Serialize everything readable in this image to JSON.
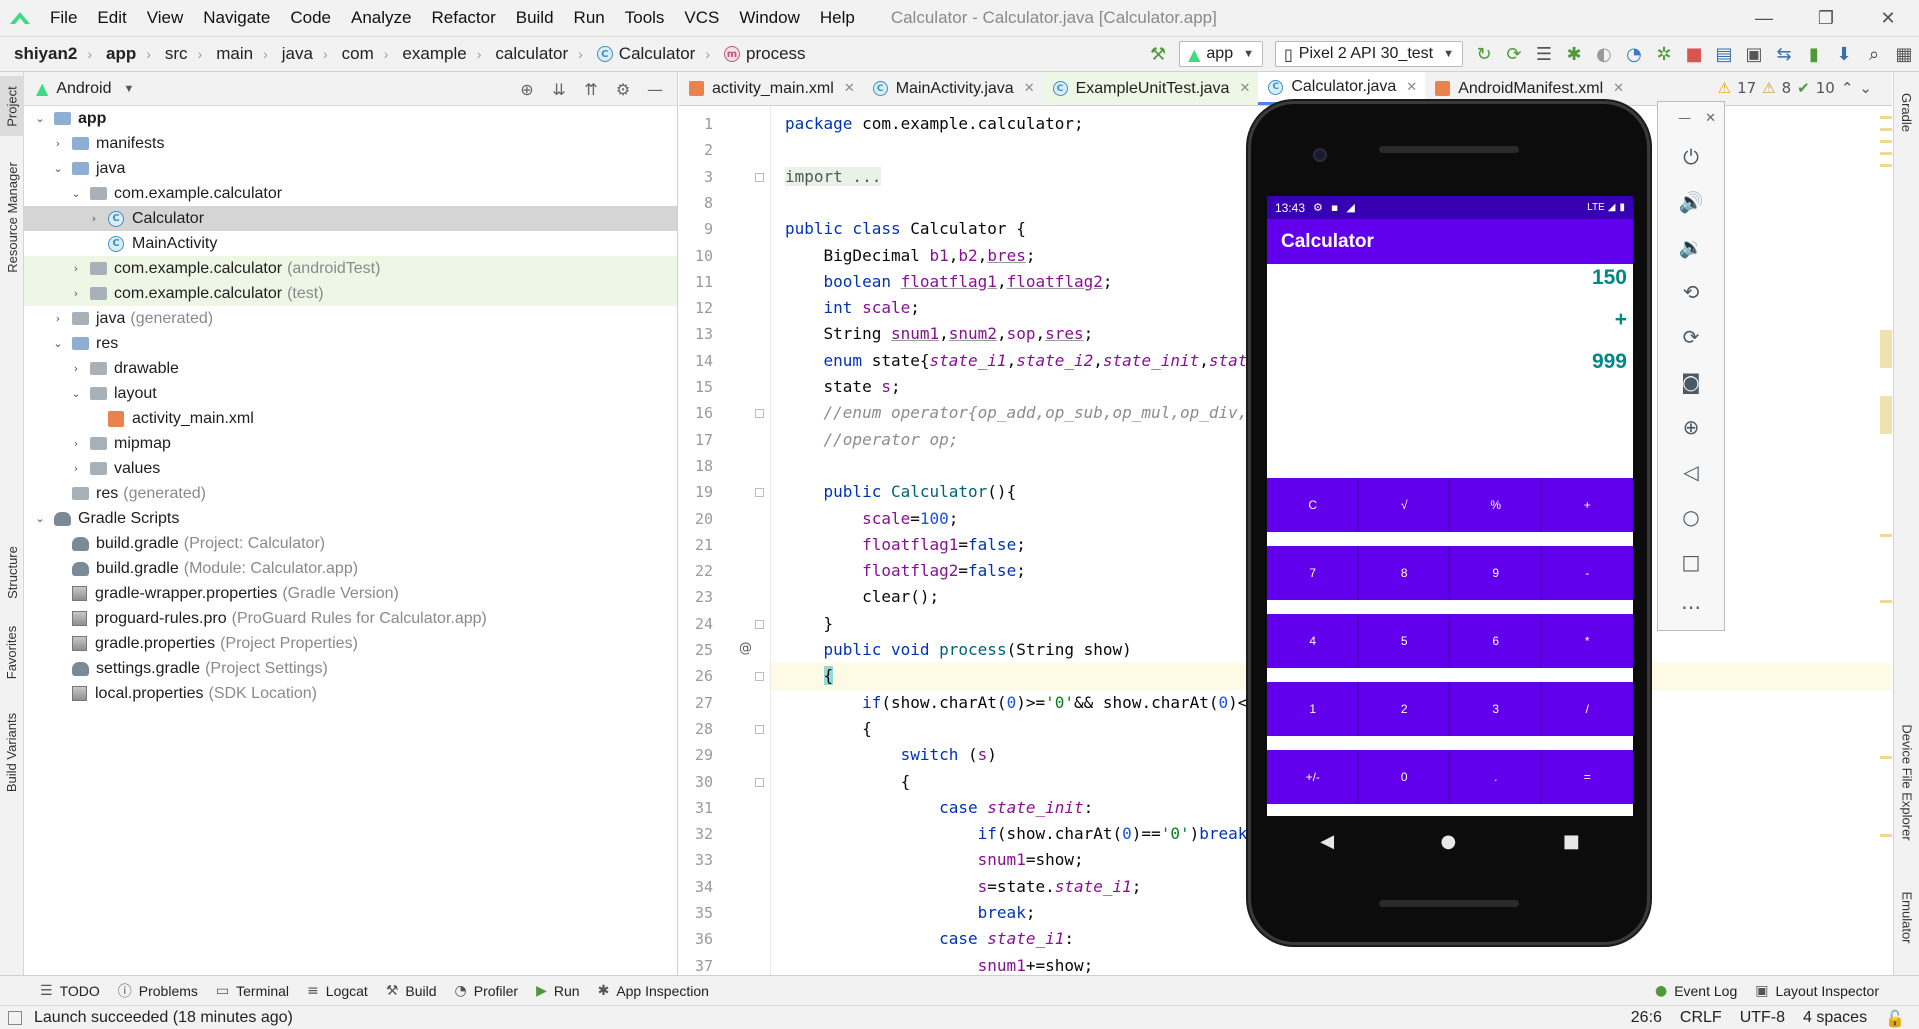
{
  "window": {
    "title": "Calculator - Calculator.java [Calculator.app]",
    "menu": [
      "File",
      "Edit",
      "View",
      "Navigate",
      "Code",
      "Analyze",
      "Refactor",
      "Build",
      "Run",
      "Tools",
      "VCS",
      "Window",
      "Help"
    ],
    "controls": [
      "—",
      "❐",
      "✕"
    ]
  },
  "breadcrumb": [
    "shiyan2",
    "app",
    "src",
    "main",
    "java",
    "com",
    "example",
    "calculator",
    "Calculator",
    "process"
  ],
  "toolbar": {
    "config": "app",
    "device": "Pixel 2 API 30_test"
  },
  "left_strip": [
    "Project",
    "Resource Manager",
    "Structure",
    "Favorites",
    "Build Variants"
  ],
  "right_strip": [
    "Gradle",
    "Device File Explorer",
    "Emulator"
  ],
  "project_panel": {
    "view_mode": "Android",
    "tree": [
      {
        "label": "app",
        "hint": "",
        "depth": 0,
        "icon": "folder",
        "chevron": "down",
        "bold": true
      },
      {
        "label": "manifests",
        "hint": "",
        "depth": 1,
        "icon": "folder",
        "chevron": "right"
      },
      {
        "label": "java",
        "hint": "",
        "depth": 1,
        "icon": "folder",
        "chevron": "down"
      },
      {
        "label": "com.example.calculator",
        "hint": "",
        "depth": 2,
        "icon": "package",
        "chevron": "down"
      },
      {
        "label": "Calculator",
        "hint": "",
        "depth": 3,
        "icon": "class",
        "chevron": "right",
        "selected": true
      },
      {
        "label": "MainActivity",
        "hint": "",
        "depth": 3,
        "icon": "class",
        "chevron": ""
      },
      {
        "label": "com.example.calculator",
        "hint": "(androidTest)",
        "depth": 2,
        "icon": "package",
        "chevron": "right",
        "test": true
      },
      {
        "label": "com.example.calculator",
        "hint": "(test)",
        "depth": 2,
        "icon": "package",
        "chevron": "right",
        "test": true
      },
      {
        "label": "java",
        "hint": "(generated)",
        "depth": 1,
        "icon": "folder-gen",
        "chevron": "right"
      },
      {
        "label": "res",
        "hint": "",
        "depth": 1,
        "icon": "folder",
        "chevron": "down"
      },
      {
        "label": "drawable",
        "hint": "",
        "depth": 2,
        "icon": "package",
        "chevron": "right"
      },
      {
        "label": "layout",
        "hint": "",
        "depth": 2,
        "icon": "package",
        "chevron": "down"
      },
      {
        "label": "activity_main.xml",
        "hint": "",
        "depth": 3,
        "icon": "xml",
        "chevron": ""
      },
      {
        "label": "mipmap",
        "hint": "",
        "depth": 2,
        "icon": "package",
        "chevron": "right"
      },
      {
        "label": "values",
        "hint": "",
        "depth": 2,
        "icon": "package",
        "chevron": "right"
      },
      {
        "label": "res",
        "hint": "(generated)",
        "depth": 1,
        "icon": "folder-gen",
        "chevron": ""
      },
      {
        "label": "Gradle Scripts",
        "hint": "",
        "depth": 0,
        "icon": "gradle",
        "chevron": "down"
      },
      {
        "label": "build.gradle",
        "hint": "(Project: Calculator)",
        "depth": 1,
        "icon": "gradle",
        "chevron": ""
      },
      {
        "label": "build.gradle",
        "hint": "(Module: Calculator.app)",
        "depth": 1,
        "icon": "gradle",
        "chevron": ""
      },
      {
        "label": "gradle-wrapper.properties",
        "hint": "(Gradle Version)",
        "depth": 1,
        "icon": "prop",
        "chevron": ""
      },
      {
        "label": "proguard-rules.pro",
        "hint": "(ProGuard Rules for Calculator.app)",
        "depth": 1,
        "icon": "prop",
        "chevron": ""
      },
      {
        "label": "gradle.properties",
        "hint": "(Project Properties)",
        "depth": 1,
        "icon": "prop",
        "chevron": ""
      },
      {
        "label": "settings.gradle",
        "hint": "(Project Settings)",
        "depth": 1,
        "icon": "gradle",
        "chevron": ""
      },
      {
        "label": "local.properties",
        "hint": "(SDK Location)",
        "depth": 1,
        "icon": "prop",
        "chevron": ""
      }
    ]
  },
  "editor": {
    "tabs": [
      {
        "label": "activity_main.xml",
        "icon": "xml"
      },
      {
        "label": "MainActivity.java",
        "icon": "class"
      },
      {
        "label": "ExampleUnitTest.java",
        "icon": "class"
      },
      {
        "label": "Calculator.java",
        "icon": "class",
        "active": true
      },
      {
        "label": "AndroidManifest.xml",
        "icon": "xml"
      }
    ],
    "inspections": {
      "warnings": "17",
      "weak_warnings": "8",
      "ok": "10"
    },
    "line_numbers": [
      "1",
      "2",
      "3",
      "8",
      "9",
      "10",
      "11",
      "12",
      "13",
      "14",
      "15",
      "16",
      "17",
      "18",
      "19",
      "20",
      "21",
      "22",
      "23",
      "24",
      "25",
      "26",
      "27",
      "28",
      "29",
      "30",
      "31",
      "32",
      "33",
      "34",
      "35",
      "36",
      "37"
    ],
    "code": [
      "<span class=\"kw\">package</span> com.example.calculator;",
      "",
      "<span class=\"fold-txt\">import ...</span>",
      "",
      "<span class=\"kw\">public class</span> Calculator {",
      "    BigDecimal <span class=\"fld\">b1</span>,<span class=\"fld\">b2</span>,<span class=\"fld ul\">bres</span>;",
      "    <span class=\"kw\">boolean</span> <span class=\"fld ul\">floatflag1</span>,<span class=\"fld ul\">floatflag2</span>;",
      "    <span class=\"kw\">int</span> <span class=\"fld\">scale</span>;",
      "    String <span class=\"fld ul\">snum1</span>,<span class=\"fld ul\">snum2</span>,<span class=\"fld\">sop</span>,<span class=\"fld ul\">sres</span>;",
      "    <span class=\"kw\">enum</span> state{<span class=\"en\">state_i1</span>,<span class=\"en\">state_i2</span>,<span class=\"en\">state_init</span>,<span class=\"en\">stat</span>",
      "    state <span class=\"fld\">s</span>;",
      "    <span class=\"cmt\">//enum operator{op_add,op_sub,op_mul,op_div,</span>",
      "    <span class=\"cmt\">//operator op;</span>",
      "",
      "    <span class=\"kw\">public</span> <span class=\"mt\">Calculator</span>(){",
      "        <span class=\"fld\">scale</span>=<span class=\"num\">100</span>;",
      "        <span class=\"fld\">floatflag1</span>=<span class=\"kw\">false</span>;",
      "        <span class=\"fld\">floatflag2</span>=<span class=\"kw\">false</span>;",
      "        clear();",
      "    }",
      "    <span class=\"kw\">public void</span> <span class=\"mt\">process</span>(String show)",
      "    <span class=\"brace-hl\">{</span>",
      "        <span class=\"kw\">if</span>(show.charAt(<span class=\"num\">0</span>)>=<span class=\"str\">'0'</span>&& show.charAt(<span class=\"num\">0</span>)<",
      "        {",
      "            <span class=\"kw\">switch</span> (<span class=\"fld\">s</span>)",
      "            {",
      "                <span class=\"kw\">case</span> <span class=\"en\">state_init</span>:",
      "                    <span class=\"kw\">if</span>(show.charAt(<span class=\"num\">0</span>)==<span class=\"str\">'0'</span>)<span class=\"kw\">break</span>",
      "                    <span class=\"fld\">snum1</span>=show;",
      "                    <span class=\"fld\">s</span>=state.<span class=\"en\">state_i1</span>;",
      "                    <span class=\"kw\">break</span>;",
      "                <span class=\"kw\">case</span> <span class=\"en\">state_i1</span>:",
      "                    <span class=\"fld\">snum1</span>+=show;"
    ]
  },
  "emulator": {
    "status_time": "13:43",
    "status_net": "LTE",
    "app_title": "Calculator",
    "display": {
      "line1": "150",
      "line2": "+",
      "line3": "999"
    },
    "keypad": [
      [
        "C",
        "√",
        "%",
        "+"
      ],
      [
        "7",
        "8",
        "9",
        "-"
      ],
      [
        "4",
        "5",
        "6",
        "*"
      ],
      [
        "1",
        "2",
        "3",
        "/"
      ],
      [
        "+/-",
        "0",
        ".",
        "="
      ]
    ],
    "colors": {
      "primary": "#6200ee",
      "primary_dark": "#3700b3",
      "accent": "#018786"
    }
  },
  "bottom_tabs": [
    "TODO",
    "Problems",
    "Terminal",
    "Logcat",
    "Build",
    "Profiler",
    "Run",
    "App Inspection"
  ],
  "bottom_right_tabs": [
    "Event Log",
    "Layout Inspector"
  ],
  "status": {
    "message": "Launch succeeded (18 minutes ago)",
    "position": "26:6",
    "line_sep": "CRLF",
    "encoding": "UTF-8",
    "indent": "4 spaces"
  }
}
